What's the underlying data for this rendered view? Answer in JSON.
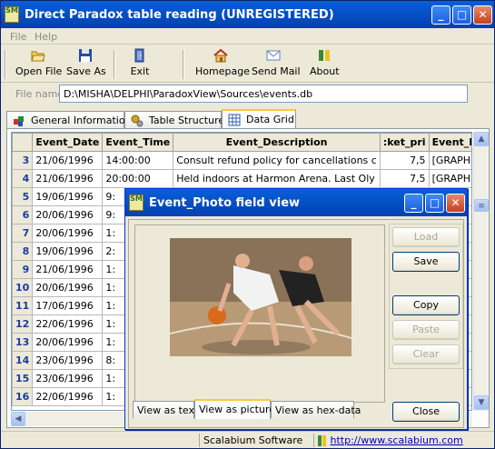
{
  "window": {
    "title": "Direct Paradox table reading  (UNREGISTERED)",
    "logo_text": "SM"
  },
  "menu": [
    "File",
    "Help"
  ],
  "toolbar": {
    "open_file": "Open File",
    "save_as": "Save As",
    "exit": "Exit",
    "homepage": "Homepage",
    "send_mail": "Send Mail",
    "about": "About"
  },
  "file": {
    "label": "File name:",
    "path": "D:\\MISHA\\DELPHI\\ParadoxView\\Sources\\events.db"
  },
  "tabs": [
    {
      "label": "General Information",
      "icon": "puzzle-icon"
    },
    {
      "label": "Table Structure",
      "icon": "gears-icon"
    },
    {
      "label": "Data Grid",
      "icon": "grid-icon"
    }
  ],
  "grid": {
    "columns": [
      "Event_Date",
      "Event_Time",
      "Event_Description",
      ":ket_pri",
      "Event_Photo"
    ],
    "rows": [
      {
        "n": "3",
        "date": "21/06/1996",
        "time": "14:00:00",
        "desc": "Consult refund policy for cancellations c",
        "price": "7,5",
        "photo": "[GRAPHIC]"
      },
      {
        "n": "4",
        "date": "21/06/1996",
        "time": "20:00:00",
        "desc": "Held indoors at Harmon Arena.  Last Oly",
        "price": "7,5",
        "photo": "[GRAPHIC]"
      },
      {
        "n": "5",
        "date": "19/06/1996",
        "time": "9:",
        "desc": "",
        "price": "",
        "photo": ""
      },
      {
        "n": "6",
        "date": "20/06/1996",
        "time": "9:",
        "desc": "",
        "price": "",
        "photo": ""
      },
      {
        "n": "7",
        "date": "20/06/1996",
        "time": "1:",
        "desc": "",
        "price": "",
        "photo": ""
      },
      {
        "n": "8",
        "date": "19/06/1996",
        "time": "2:",
        "desc": "",
        "price": "",
        "photo": ""
      },
      {
        "n": "9",
        "date": "21/06/1996",
        "time": "1:",
        "desc": "",
        "price": "",
        "photo": ""
      },
      {
        "n": "10",
        "date": "20/06/1996",
        "time": "1:",
        "desc": "",
        "price": "",
        "photo": ""
      },
      {
        "n": "11",
        "date": "17/06/1996",
        "time": "1:",
        "desc": "",
        "price": "",
        "photo": ""
      },
      {
        "n": "12",
        "date": "22/06/1996",
        "time": "1:",
        "desc": "",
        "price": "",
        "photo": ""
      },
      {
        "n": "13",
        "date": "20/06/1996",
        "time": "1:",
        "desc": "",
        "price": "",
        "photo": ""
      },
      {
        "n": "14",
        "date": "23/06/1996",
        "time": "8:",
        "desc": "",
        "price": "",
        "photo": ""
      },
      {
        "n": "15",
        "date": "23/06/1996",
        "time": "1:",
        "desc": "",
        "price": "",
        "photo": ""
      },
      {
        "n": "16",
        "date": "22/06/1996",
        "time": "1:",
        "desc": "",
        "price": "",
        "photo": ""
      }
    ]
  },
  "dialog": {
    "title": "Event_Photo field view",
    "buttons": {
      "load": "Load",
      "save": "Save",
      "copy": "Copy",
      "paste": "Paste",
      "clear": "Clear",
      "close": "Close"
    },
    "tabs": [
      "View as text",
      "View as picture",
      "View as hex-data"
    ]
  },
  "status": {
    "company": "Scalabium Software",
    "url": "http://www.scalabium.com"
  }
}
